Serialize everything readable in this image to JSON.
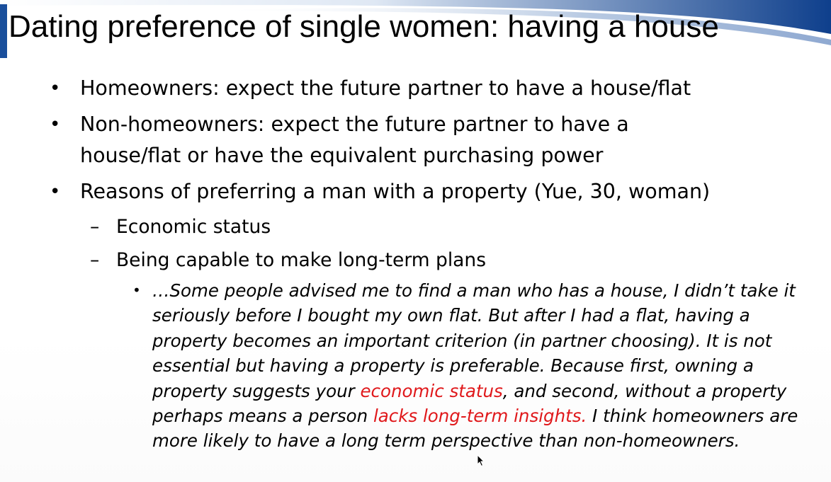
{
  "slide": {
    "title": "Dating preference of single women: having a house",
    "bullets": [
      {
        "marker": "•",
        "text": "Homeowners: expect the future partner to have a house/flat"
      },
      {
        "marker": "•",
        "line1": "Non-homeowners: expect the future partner to have a",
        "line2": "house/flat or have the equivalent purchasing power"
      },
      {
        "marker": "•",
        "text": "Reasons of preferring a man with a property (Yue, 30, woman)"
      }
    ],
    "sub_bullets": [
      {
        "marker": "–",
        "text": "Economic status"
      },
      {
        "marker": "–",
        "text": "Being capable to make long-term plans"
      }
    ],
    "quote": {
      "marker": "•",
      "part1": "…Some people advised me to find a man who has a house, I didn’t take it seriously before I bought my own flat. But after I had a flat, having a property becomes an important criterion (in partner choosing). It is not essential but having a property is preferable. Because first, owning a property suggests your ",
      "highlight1": "economic status",
      "part2": ", and second, without a property perhaps means a person ",
      "highlight2": "lacks long-term insights.",
      "part3": " I think homeowners  are more likely to have a long term perspective than non-homeowners."
    }
  },
  "colors": {
    "title_bar": "#1a4f9c",
    "highlight": "#e0181b"
  },
  "icons": [
    "mouse-cursor-icon"
  ]
}
